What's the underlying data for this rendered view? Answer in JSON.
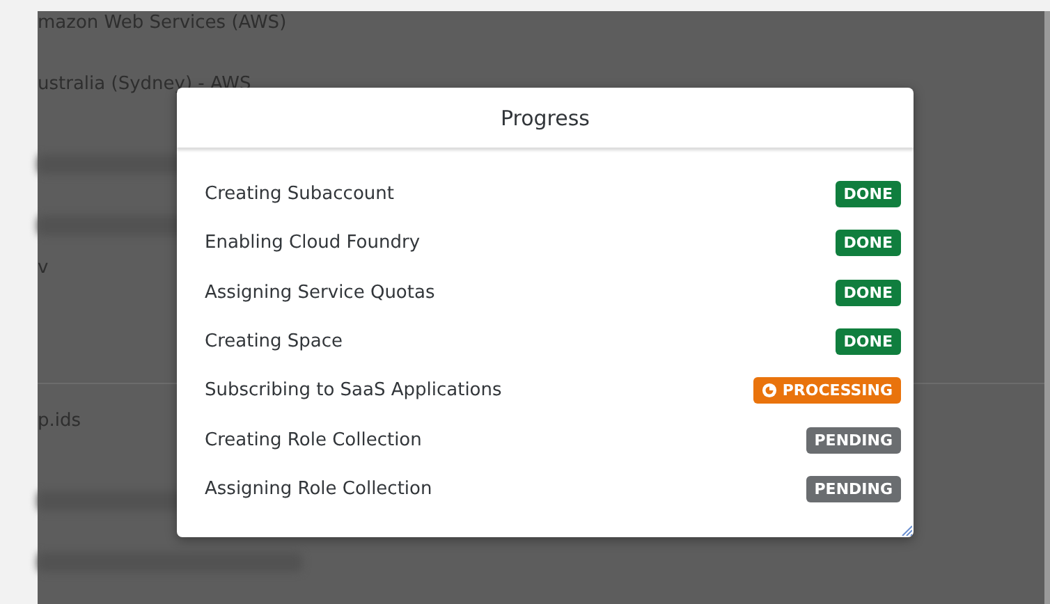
{
  "background": {
    "lines": [
      {
        "kind": "text",
        "text": "mazon Web Services (AWS)"
      },
      {
        "kind": "text",
        "text": "ustralia (Sydney) - AWS"
      },
      {
        "kind": "blur"
      },
      {
        "kind": "blur"
      },
      {
        "kind": "text",
        "text": "v"
      },
      {
        "kind": "gap"
      },
      {
        "kind": "divider"
      },
      {
        "kind": "text",
        "text": "p.ids"
      },
      {
        "kind": "blur"
      },
      {
        "kind": "blur"
      }
    ]
  },
  "dialog": {
    "title": "Progress",
    "steps": [
      {
        "label": "Creating Subaccount",
        "kind": "done",
        "badge": "DONE"
      },
      {
        "label": "Enabling Cloud Foundry",
        "kind": "done",
        "badge": "DONE"
      },
      {
        "label": "Assigning Service Quotas",
        "kind": "done",
        "badge": "DONE"
      },
      {
        "label": "Creating Space",
        "kind": "done",
        "badge": "DONE"
      },
      {
        "label": "Subscribing to SaaS Applications",
        "kind": "processing",
        "badge": "PROCESSING"
      },
      {
        "label": "Creating Role Collection",
        "kind": "pending",
        "badge": "PENDING"
      },
      {
        "label": "Assigning Role Collection",
        "kind": "pending",
        "badge": "PENDING"
      }
    ]
  }
}
